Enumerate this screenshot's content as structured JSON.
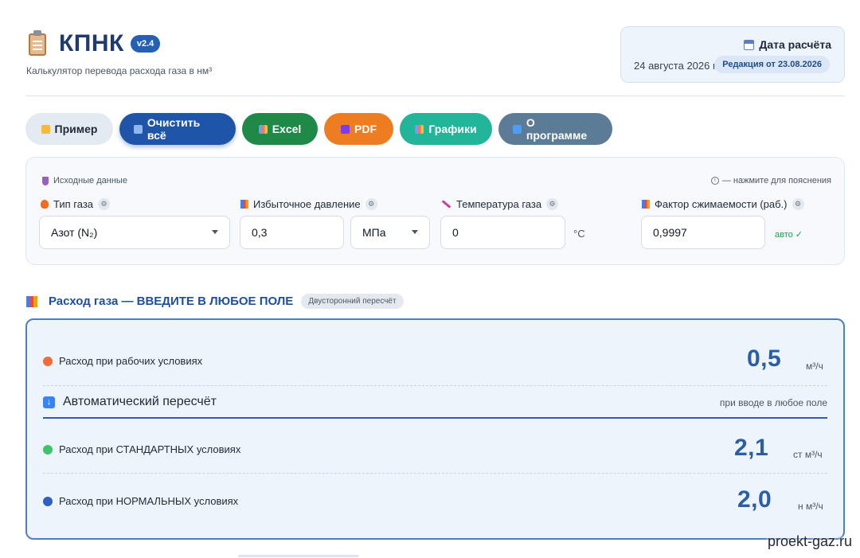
{
  "header": {
    "title": "КПНК",
    "version": "v2.4",
    "subtitle": "Калькулятор перевода расхода газа в нм³"
  },
  "date_card": {
    "title": "Дата расчёта",
    "date": "24 августа 2026 г.",
    "edition": "Редакция от 23.08.2026"
  },
  "toolbar": {
    "example": "Пример",
    "clear": "Очистить всё",
    "excel": "Excel",
    "pdf": "PDF",
    "charts": "Графики",
    "about": "О программе"
  },
  "inputs": {
    "section_label": "Исходные данные",
    "hint": "— нажмите для пояснения",
    "gas_type": {
      "label": "Тип газа",
      "value": "Азот (N₂)"
    },
    "pressure": {
      "label": "Избыточное давление",
      "value": "0,3",
      "unit": "МПа"
    },
    "temperature": {
      "label": "Температура газа",
      "value": "0",
      "unit": "°C"
    },
    "compressibility": {
      "label": "Фактор сжимаемости (раб.)",
      "value": "0,9997",
      "auto": "авто ✓"
    }
  },
  "flow": {
    "heading": "Расход газа — ВВЕДИТЕ В ЛЮБОЕ ПОЛЕ",
    "badge": "Двусторонний пересчёт",
    "working": {
      "label": "Расход при рабочих условиях",
      "value": "0,5",
      "unit": "м³/ч"
    },
    "auto_title": "Автоматический пересчёт",
    "auto_hint": "при вводе в любое поле",
    "standard": {
      "label": "Расход при СТАНДАРТНЫХ условиях",
      "value": "2,1",
      "unit": "ст м³/ч"
    },
    "normal": {
      "label": "Расход при НОРМАЛЬНЫХ условиях",
      "value": "2,0",
      "unit": "н м³/ч"
    }
  },
  "watermark": "proekt-gaz.ru",
  "colors": {
    "accent": "#1e55a8",
    "excel": "#1f8a48",
    "pdf": "#ee7d22",
    "charts": "#22b59a",
    "about": "#5c7b96",
    "dot_working": "#f26b3a",
    "dot_standard": "#3cc36b",
    "dot_normal": "#2f5fc0"
  }
}
